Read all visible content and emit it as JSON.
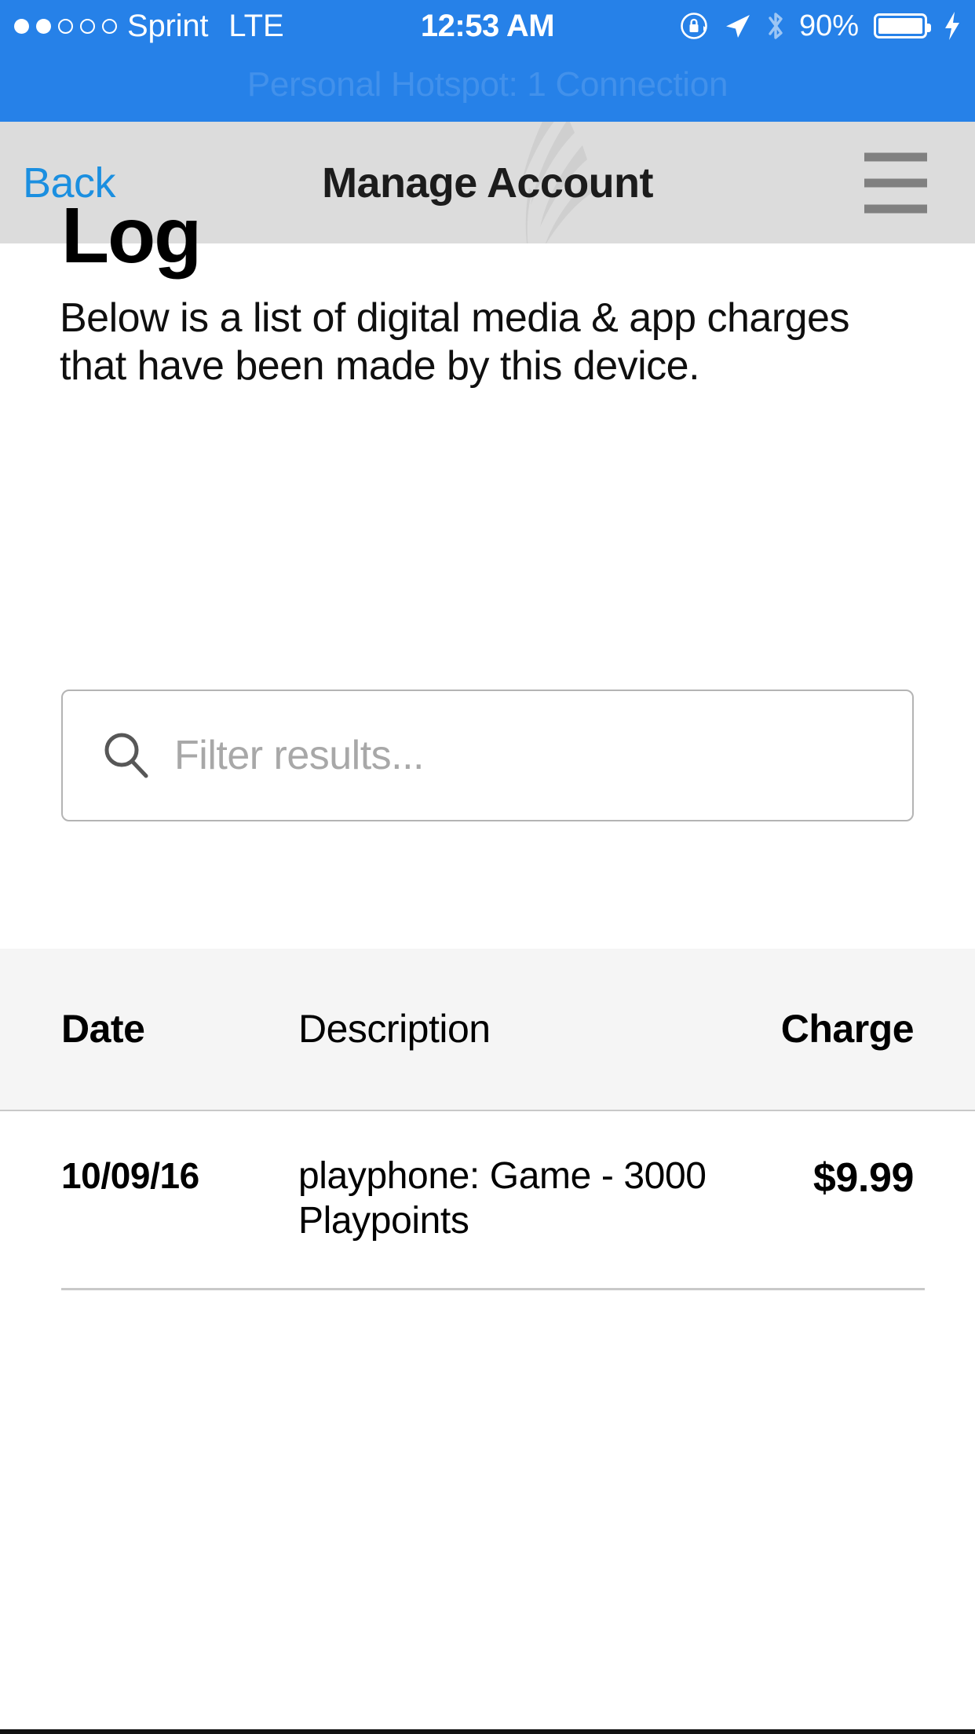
{
  "statusbar": {
    "signal_dots_filled": 2,
    "signal_dots_total": 5,
    "carrier": "Sprint",
    "network": "LTE",
    "time": "12:53 AM",
    "battery_percent": "90%",
    "icons": [
      "rotation-lock-icon",
      "location-arrow-icon",
      "bluetooth-icon",
      "battery-icon",
      "charging-bolt-icon"
    ]
  },
  "hotspot": {
    "banner_text": "Personal Hotspot: 1 Connection",
    "background_color": "#2681e8"
  },
  "navbar": {
    "back_label": "Back",
    "title": "Manage Account",
    "menu_icon": "hamburger-menu-icon",
    "background_color": "#dcdcdc",
    "link_color": "#1b8fe0"
  },
  "page": {
    "heading": "Log",
    "intro": "Below is a list of digital media & app charges that have been made by this device."
  },
  "search": {
    "placeholder": "Filter results...",
    "value": "",
    "icon": "search-icon"
  },
  "table": {
    "headers": {
      "date": "Date",
      "description": "Description",
      "charge": "Charge"
    },
    "rows": [
      {
        "date": "10/09/16",
        "description": "playphone: Game - 3000 Playpoints",
        "charge": "$9.99"
      }
    ]
  }
}
